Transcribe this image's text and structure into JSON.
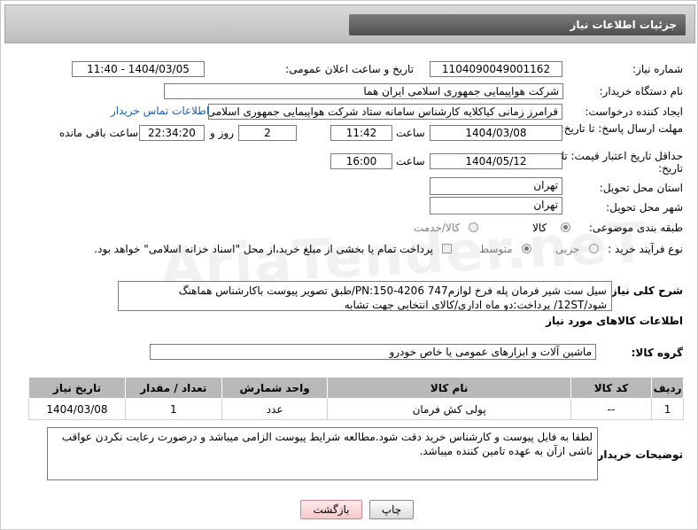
{
  "header": {
    "title": "جزئیات اطلاعات نیاز"
  },
  "need_number": {
    "label": "شماره نیاز:",
    "value": "1104090049001162"
  },
  "announce": {
    "label": "تاریخ و ساعت اعلان عمومی:",
    "value": "1404/03/05 - 11:40"
  },
  "buyer_org": {
    "label": "نام دستگاه خریدار:",
    "value": "شرکت هواپیمایی جمهوری اسلامی ایران هما"
  },
  "creator": {
    "label": "ایجاد کننده درخواست:",
    "value": "قرامرز زمانی کیاکلایه کارشناس سامانه ستاد شرکت هواپیمایی جمهوری اسلامی",
    "contact_link": "اطلاعات تماس خریدار"
  },
  "deadline": {
    "label": "مهلت ارسال پاسخ: تا تاریخ:",
    "date": "1404/03/08",
    "time_label": "ساعت",
    "time": "11:42",
    "days": "2",
    "days_label": "روز و",
    "remaining": "22:34:20",
    "remaining_label": "ساعت باقی مانده"
  },
  "price_validity": {
    "label": "حداقل تاریخ اعتبار قیمت: تا تاریخ:",
    "date": "1404/05/12",
    "time_label": "ساعت",
    "time": "16:00"
  },
  "province": {
    "label": "استان محل تحویل:",
    "value": "تهران"
  },
  "city": {
    "label": "شهر محل تحویل:",
    "value": "تهران"
  },
  "category": {
    "label": "طبقه بندی موضوعی:",
    "options": [
      "کالا",
      "کالا/خدمت"
    ],
    "selected": "کالا"
  },
  "process": {
    "label": "نوع فرآیند خرید :",
    "options": [
      "جزیی",
      "متوسط"
    ],
    "selected": "متوسط",
    "payment_note": "پرداخت تمام یا بخشی از مبلغ خرید،از محل \"اسناد خزانه اسلامی\" خواهد بود."
  },
  "need_summary": {
    "label": "شرح کلی نیاز:",
    "text": "سیل ست شیر فرمان پله فرخ لوازم747 PN:150-4206/طبق تصویر پیوست باکارشناس هماهنگ شود/12ST/ پرداخت:دو ماه اداری/کالای انتخابی جهت تشابه"
  },
  "goods_info": {
    "title": "اطلاعات کالاهای مورد نیاز"
  },
  "goods_group": {
    "label": "گروه کالا:",
    "value": "ماشین آلات و ابزارهای عمومی یا خاص خودرو"
  },
  "table": {
    "headers": [
      "ردیف",
      "کد کالا",
      "نام کالا",
      "واحد شمارش",
      "تعداد / مقدار",
      "تاریخ نیاز"
    ],
    "rows": [
      [
        "1",
        "--",
        "پولی کش فرمان",
        "عدد",
        "1",
        "1404/03/08"
      ]
    ]
  },
  "buyer_notes": {
    "label": "توضیحات خریدار:",
    "text": "لطفا به فایل پیوست و کارشناس خرید دقت شود.مطالعه شرایط پیوست الزامی میباشد و درصورت رعایت نکردن عواقب ناشی ازآن به عهده تامین کننده میباشد."
  },
  "buttons": {
    "print": "چاپ",
    "back": "بازگشت"
  },
  "watermark": "AriaTender.neT"
}
